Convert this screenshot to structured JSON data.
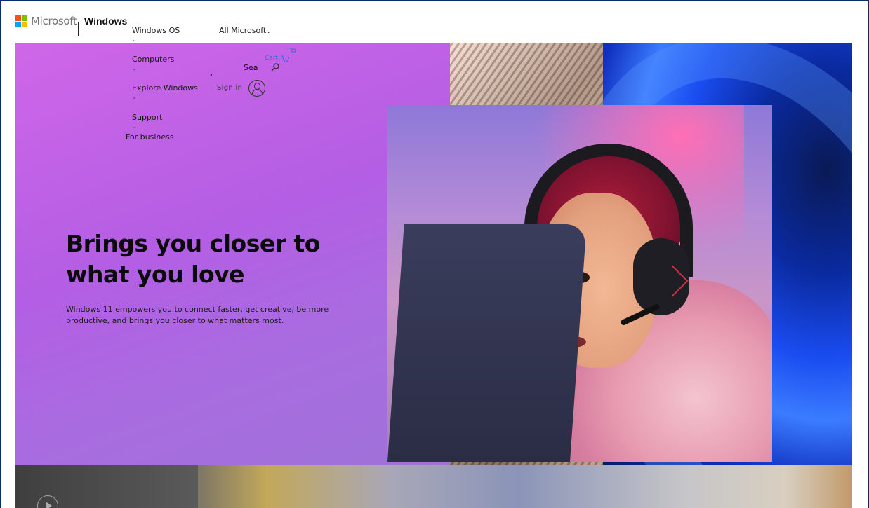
{
  "header": {
    "brand_logo_text": "Microsoft",
    "brand_product": "Windows",
    "logo_colors": [
      "#f25022",
      "#7fba00",
      "#00a4ef",
      "#ffb900"
    ]
  },
  "nav": {
    "items": [
      {
        "label": "Windows OS",
        "has_chevron": true
      },
      {
        "label": "Computers",
        "has_chevron": true
      },
      {
        "label": "Explore Windows",
        "has_chevron": true
      },
      {
        "label": "Support",
        "has_chevron": true
      },
      {
        "label": "For business",
        "has_chevron": false
      }
    ],
    "all_microsoft": "All Microsoft",
    "chevron_glyph": "⌄",
    "cart_label": "Cart",
    "search_label": "Sea",
    "sign_in": "Sign in"
  },
  "hero": {
    "title": "Brings you closer to what you love",
    "description": "Windows 11 empowers you to connect faster, get creative, be more productive, and brings you closer to what matters most."
  },
  "colors": {
    "hero_gradient_start": "#d066e8",
    "hero_gradient_end": "#9f72d8",
    "link_blue": "#1a6fd8"
  }
}
